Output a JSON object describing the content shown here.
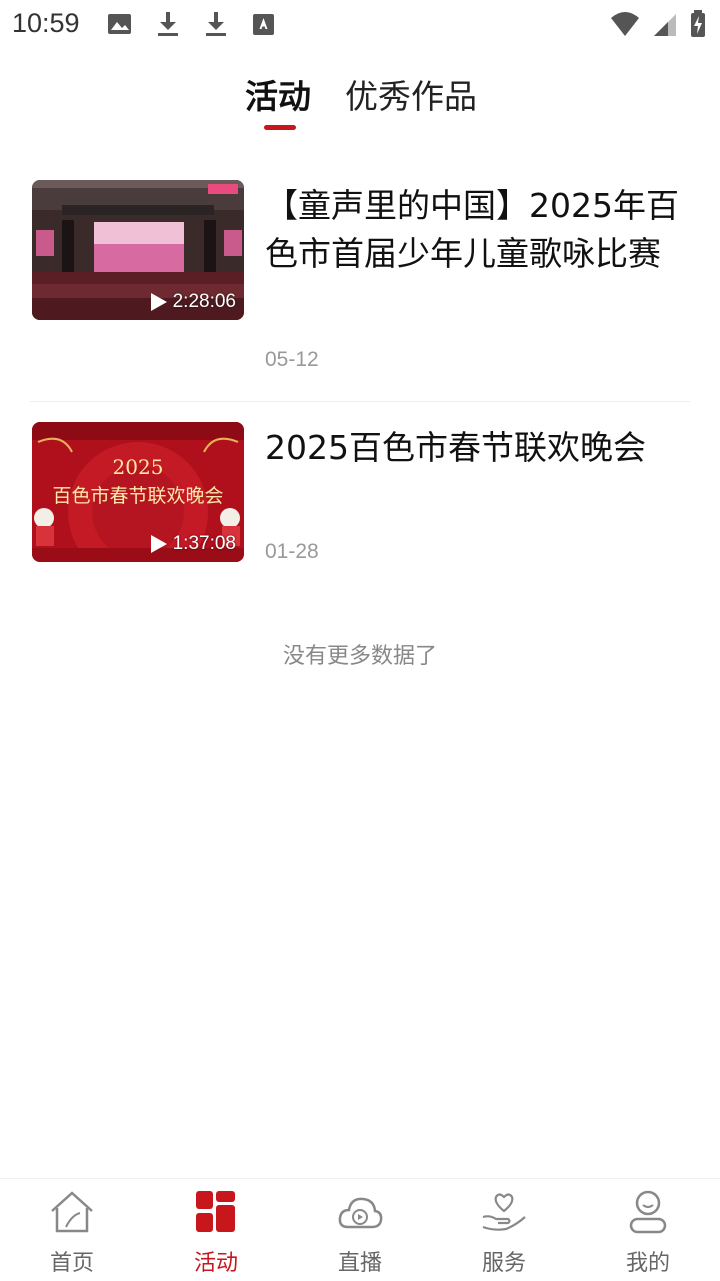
{
  "status_bar": {
    "time": "10:59",
    "left_icons": [
      "image-icon",
      "download-icon",
      "download-icon",
      "text-icon"
    ],
    "right_icons": [
      "wifi-icon",
      "signal-icon",
      "battery-charging-icon"
    ]
  },
  "tabs": [
    {
      "label": "活动",
      "active": true
    },
    {
      "label": "优秀作品",
      "active": false
    }
  ],
  "accent_color": "#c8161d",
  "videos": [
    {
      "title": "【童声里的中国】2025年百色市首届少年儿童歌咏比赛",
      "duration": "2:28:06",
      "date": "05-12",
      "thumbnail": "stage-performance-photo"
    },
    {
      "title": "2025百色市春节联欢晚会",
      "duration": "1:37:08",
      "date": "01-28",
      "thumbnail": "spring-festival-gala-poster"
    }
  ],
  "thumb2_text": {
    "year": "2025",
    "headline": "百色市春节联欢晚会"
  },
  "no_more_text": "没有更多数据了",
  "bottom_nav": [
    {
      "label": "首页",
      "icon": "home-icon",
      "active": false
    },
    {
      "label": "活动",
      "icon": "activity-grid-icon",
      "active": true
    },
    {
      "label": "直播",
      "icon": "live-cloud-icon",
      "active": false
    },
    {
      "label": "服务",
      "icon": "service-hand-heart-icon",
      "active": false
    },
    {
      "label": "我的",
      "icon": "profile-icon",
      "active": false
    }
  ]
}
